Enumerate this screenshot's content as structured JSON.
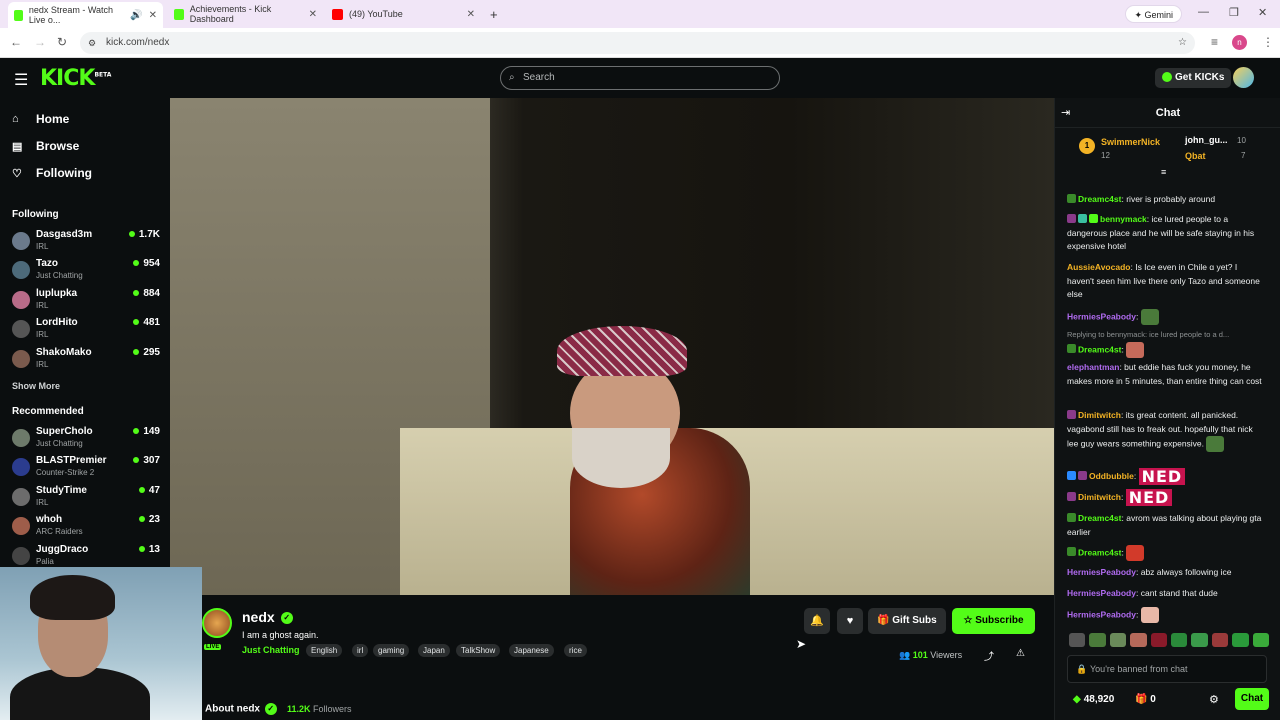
{
  "browser": {
    "tabs": [
      {
        "title": "nedx Stream - Watch Live o...",
        "active": true,
        "favicon_color": "#53fc18"
      },
      {
        "title": "Achievements - Kick Dashboard",
        "active": false,
        "favicon_color": "#53fc18"
      },
      {
        "title": "(49) YouTube",
        "active": false,
        "favicon_color": "#ff0000"
      }
    ],
    "url": "kick.com/nedx",
    "gemini_label": "Gemini",
    "profile_initial": "n"
  },
  "header": {
    "logo": "KICK",
    "logo_badge": "BETA",
    "search_placeholder": "Search",
    "get_kicks_label": "Get KICKs"
  },
  "sidebar": {
    "nav": [
      {
        "label": "Home",
        "icon": "home-icon"
      },
      {
        "label": "Browse",
        "icon": "browse-icon"
      },
      {
        "label": "Following",
        "icon": "heart-icon"
      }
    ],
    "following_heading": "Following",
    "following": [
      {
        "name": "Dasgasd3m",
        "category": "IRL",
        "viewers": "1.7K"
      },
      {
        "name": "Tazo",
        "category": "Just Chatting",
        "viewers": "954"
      },
      {
        "name": "luplupka",
        "category": "IRL",
        "viewers": "884"
      },
      {
        "name": "LordHito",
        "category": "IRL",
        "viewers": "481"
      },
      {
        "name": "ShakoMako",
        "category": "IRL",
        "viewers": "295"
      }
    ],
    "show_more": "Show More",
    "recommended_heading": "Recommended",
    "recommended": [
      {
        "name": "SuperCholo",
        "category": "Just Chatting",
        "viewers": "149"
      },
      {
        "name": "BLASTPremier",
        "category": "Counter-Strike 2",
        "viewers": "307"
      },
      {
        "name": "StudyTime",
        "category": "IRL",
        "viewers": "47"
      },
      {
        "name": "whoh",
        "category": "ARC Raiders",
        "viewers": "23"
      },
      {
        "name": "JuggDraco",
        "category": "Palia",
        "viewers": "13"
      }
    ]
  },
  "stream": {
    "channel": "nedx",
    "live_label": "LIVE",
    "title": "I am a ghost again.",
    "category": "Just Chatting",
    "tags": [
      "English",
      "irl",
      "gaming",
      "Japan",
      "TalkShow",
      "Japanese",
      "rice"
    ],
    "gift_subs_label": "Gift Subs",
    "subscribe_label": "Subscribe",
    "viewers_count": "101",
    "viewers_label": "Viewers",
    "about_label": "About nedx",
    "followers_count": "11.2K",
    "followers_label": "Followers"
  },
  "chat": {
    "title": "Chat",
    "leaderboard": [
      {
        "rank": "1",
        "name": "SwimmerNick",
        "count": "12"
      },
      {
        "name": "john_gu...",
        "count": "10"
      },
      {
        "name": "Qbat",
        "count": "7"
      }
    ],
    "messages": [
      {
        "user": "Dreamc4st",
        "color": "#53fc18",
        "text": "river is probably around"
      },
      {
        "user": "bennymack",
        "color": "#53fc18",
        "text": "ice lured people to a dangerous place and he will be safe staying in his expensive hotel"
      },
      {
        "user": "AussieAvocado",
        "color": "#f3b325",
        "text": "Is Ice even in Chile ɑ yet? I haven't seen him live there only Tazo and someone else"
      },
      {
        "user": "HermiesPeabody",
        "color": "#b06bf0",
        "text": ""
      },
      {
        "reply": "Replying to bennymack: ice lured people to a d...",
        "user": "Dreamc4st",
        "color": "#53fc18",
        "text": ""
      },
      {
        "user": "elephantman",
        "color": "#b06bf0",
        "text": "but eddie has fuck you money, he makes more in 5 minutes, than entire thing can cost"
      },
      {
        "user": "Dimitwitch",
        "color": "#f3b325",
        "text": "its great content. all panicked. vagabond still has to freak out. hopefully that nick lee guy wears something expensive."
      },
      {
        "user": "Oddbubble",
        "color": "#f3b325",
        "text": "NED"
      },
      {
        "user": "Dimitwitch",
        "color": "#f3b325",
        "text": "NED"
      },
      {
        "user": "Dreamc4st",
        "color": "#53fc18",
        "text": "avrom was talking about playing gta earlier"
      },
      {
        "user": "Dreamc4st",
        "color": "#53fc18",
        "text": ""
      },
      {
        "user": "HermiesPeabody",
        "color": "#b06bf0",
        "text": "abz always following ice"
      },
      {
        "user": "HermiesPeabody",
        "color": "#b06bf0",
        "text": "cant stand that dude"
      },
      {
        "user": "HermiesPeabody",
        "color": "#b06bf0",
        "text": ""
      }
    ],
    "input_placeholder": "You're banned from chat",
    "kicks_balance": "48,920",
    "gift_count": "0",
    "send_label": "Chat"
  },
  "colors": {
    "accent": "#53fc18",
    "bg": "#0b0e0f"
  }
}
